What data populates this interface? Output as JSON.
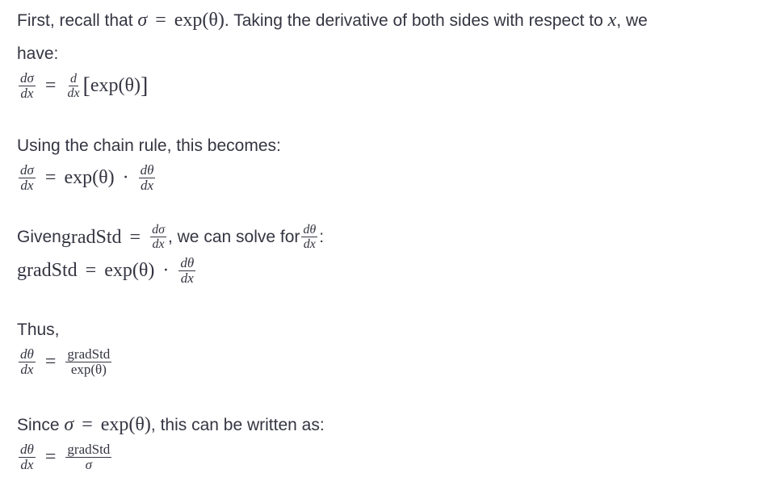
{
  "p1": {
    "text_a": "First, recall that ",
    "math_sigma": "σ",
    "math_eq": "=",
    "math_exp": "exp(θ)",
    "text_b": ". Taking the derivative of both sides with respect to ",
    "math_x": "x",
    "text_c": ", we",
    "text_d": "have:"
  },
  "eq1": {
    "lhs_num": "dσ",
    "lhs_den": "dx",
    "eq": "=",
    "d_num": "d",
    "d_den": "dx",
    "bracket_open": "[",
    "body": "exp(θ)",
    "bracket_close": "]"
  },
  "p2": {
    "text": "Using the chain rule, this becomes:"
  },
  "eq2": {
    "lhs_num": "dσ",
    "lhs_den": "dx",
    "eq": "=",
    "exp": "exp(θ)",
    "dot": "·",
    "rhs_num": "dθ",
    "rhs_den": "dx"
  },
  "p3": {
    "text_a": "Given ",
    "math_grad": "gradStd",
    "math_eq": "=",
    "frac_num": "dσ",
    "frac_den": "dx",
    "text_b": ", we can solve for ",
    "frac2_num": "dθ",
    "frac2_den": "dx",
    "text_c": ":"
  },
  "eq3": {
    "grad": "gradStd",
    "eq": "=",
    "exp": "exp(θ)",
    "dot": "·",
    "rhs_num": "dθ",
    "rhs_den": "dx"
  },
  "p4": {
    "text": "Thus,"
  },
  "eq4": {
    "lhs_num": "dθ",
    "lhs_den": "dx",
    "eq": "=",
    "rhs_num": "gradStd",
    "rhs_den": "exp(θ)"
  },
  "p5": {
    "text_a": "Since ",
    "math_sigma": "σ",
    "math_eq": "=",
    "math_exp": "exp(θ)",
    "text_b": ", this can be written as:"
  },
  "eq5": {
    "lhs_num": "dθ",
    "lhs_den": "dx",
    "eq": "=",
    "rhs_num": "gradStd",
    "rhs_den": "σ"
  }
}
